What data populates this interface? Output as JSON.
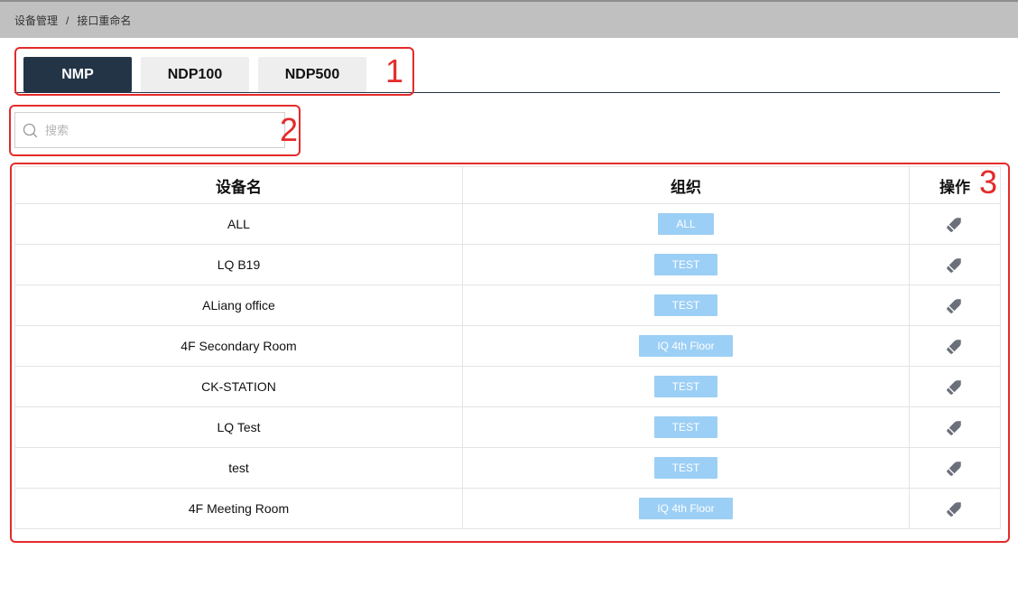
{
  "breadcrumb": {
    "items": [
      "设备管理",
      "接口重命名"
    ],
    "separator": "/"
  },
  "tabs": [
    {
      "label": "NMP",
      "active": true
    },
    {
      "label": "NDP100",
      "active": false
    },
    {
      "label": "NDP500",
      "active": false
    }
  ],
  "search": {
    "placeholder": "搜索",
    "value": ""
  },
  "table": {
    "columns": [
      "设备名",
      "组织",
      "操作"
    ],
    "rows": [
      {
        "name": "ALL",
        "org": "ALL"
      },
      {
        "name": "LQ B19",
        "org": "TEST"
      },
      {
        "name": "ALiang office",
        "org": "TEST"
      },
      {
        "name": "4F Secondary Room",
        "org": "IQ 4th Floor"
      },
      {
        "name": "CK-STATION",
        "org": "TEST"
      },
      {
        "name": "LQ Test",
        "org": "TEST"
      },
      {
        "name": "test",
        "org": "TEST"
      },
      {
        "name": "4F Meeting Room",
        "org": "IQ 4th Floor"
      }
    ],
    "action_icon": "pencil-icon"
  },
  "annotations": [
    "1",
    "2",
    "3"
  ],
  "colors": {
    "header_bar": "#c0c0c0",
    "tab_active": "#233446",
    "tab_inactive": "#eeeeee",
    "badge": "#9ccff5",
    "annotation": "#e52a2a",
    "icon": "#6b6f7a"
  }
}
